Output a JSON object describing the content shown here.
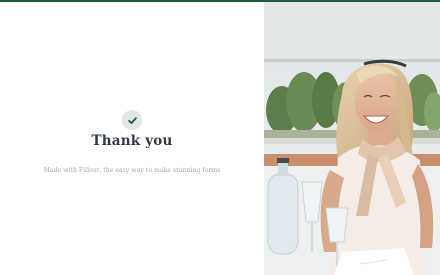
{
  "confirmation": {
    "title": "Thank you",
    "made_with": "Made with Fillout, the easy way to make stunning forms"
  },
  "icons": {
    "status": "checkmark-icon"
  },
  "colors": {
    "accent": "#1f5b3b",
    "title": "#2e3a45",
    "muted": "#a3a8ad",
    "badge_bg": "#e3e8e5"
  }
}
